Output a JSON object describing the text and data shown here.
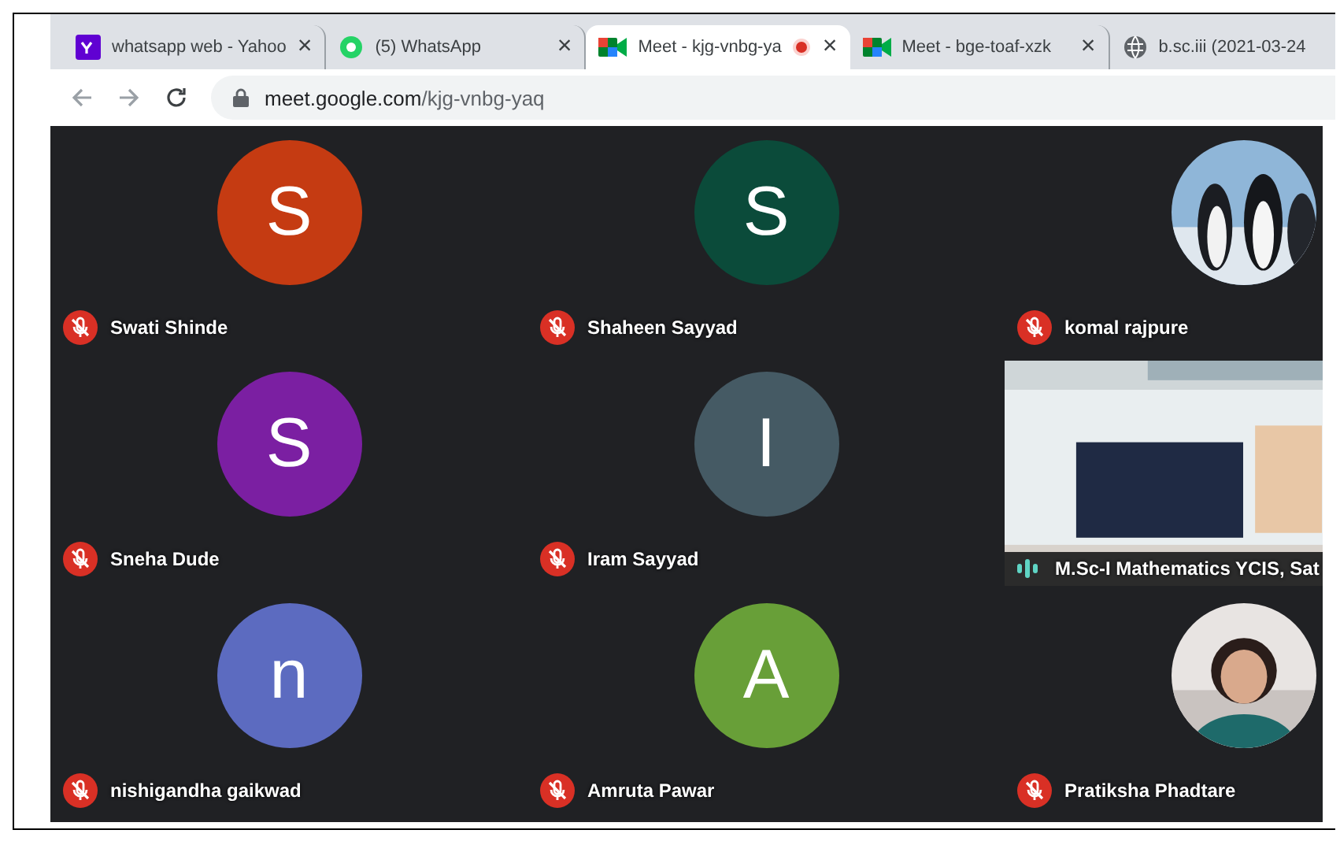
{
  "browser": {
    "tabs": [
      {
        "title": "whatsapp web - Yahoo",
        "selected": false,
        "recording": false,
        "close": "×"
      },
      {
        "title": "(5) WhatsApp",
        "selected": false,
        "recording": false,
        "close": "×"
      },
      {
        "title": "Meet - kjg-vnbg-ya",
        "selected": true,
        "recording": true,
        "close": "×"
      },
      {
        "title": "Meet - bge-toaf-xzk",
        "selected": false,
        "recording": false,
        "close": "×"
      },
      {
        "title": "b.sc.iii (2021-03-24",
        "selected": false,
        "recording": false
      }
    ],
    "address": {
      "host": "meet.google.com",
      "path": "/kjg-vnbg-yaq"
    }
  },
  "participants": [
    {
      "name": "Swati Shinde",
      "kind": "letter",
      "letter": "S",
      "color": "#c53b12",
      "muted": true
    },
    {
      "name": "Shaheen Sayyad",
      "kind": "letter",
      "letter": "S",
      "color": "#0b4b3a",
      "muted": true
    },
    {
      "name": "komal rajpure",
      "kind": "picture",
      "muted": true
    },
    {
      "name": "Sneha Dude",
      "kind": "letter",
      "letter": "S",
      "color": "#7b1fa2",
      "muted": true
    },
    {
      "name": "Iram Sayyad",
      "kind": "letter",
      "letter": "I",
      "color": "#455a64",
      "muted": true
    },
    {
      "name": "M.Sc-I Mathematics YCIS, Sat",
      "kind": "video",
      "muted": false
    },
    {
      "name": "nishigandha gaikwad",
      "kind": "letter",
      "letter": "n",
      "color": "#5c6bc0",
      "muted": true
    },
    {
      "name": "Amruta Pawar",
      "kind": "letter",
      "letter": "A",
      "color": "#689f38",
      "muted": true
    },
    {
      "name": "Pratiksha Phadtare",
      "kind": "picture",
      "muted": true
    }
  ]
}
